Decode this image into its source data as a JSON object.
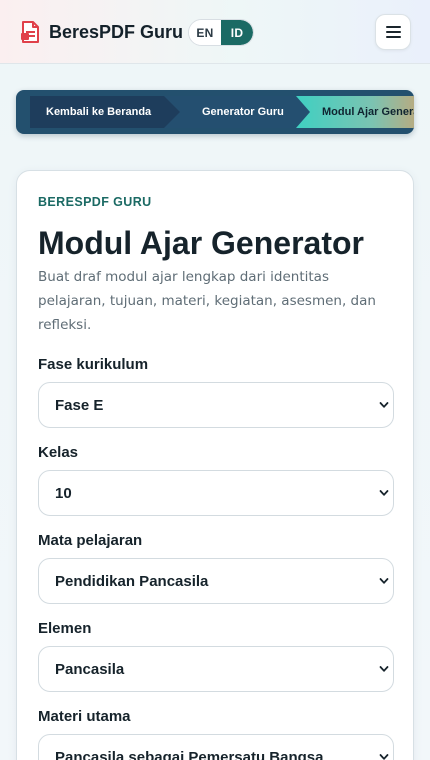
{
  "header": {
    "brand": "BeresPDF Guru",
    "lang_en": "EN",
    "lang_id": "ID",
    "logo_icon": "pdf-file-icon",
    "menu_icon": "hamburger-menu-icon"
  },
  "breadcrumb": {
    "items": [
      "Kembali ke Beranda",
      "Generator Guru",
      "Modul Ajar Generator"
    ]
  },
  "card": {
    "eyebrow": "BERESPDF GURU",
    "title": "Modul Ajar Generator",
    "description": "Buat draf modul ajar lengkap dari identitas pelajaran, tujuan, materi, kegiatan, asesmen, dan refleksi."
  },
  "form": {
    "fields": [
      {
        "label": "Fase kurikulum",
        "value": "Fase E"
      },
      {
        "label": "Kelas",
        "value": "10"
      },
      {
        "label": "Mata pelajaran",
        "value": "Pendidikan Pancasila"
      },
      {
        "label": "Elemen",
        "value": "Pancasila"
      },
      {
        "label": "Materi utama",
        "value": "Pancasila sebagai Pemersatu Bangsa"
      }
    ]
  },
  "colors": {
    "accent": "#1b6a64",
    "breadcrumb_dark": "#1e3d5c",
    "breadcrumb_active": "#3fd0c2"
  }
}
